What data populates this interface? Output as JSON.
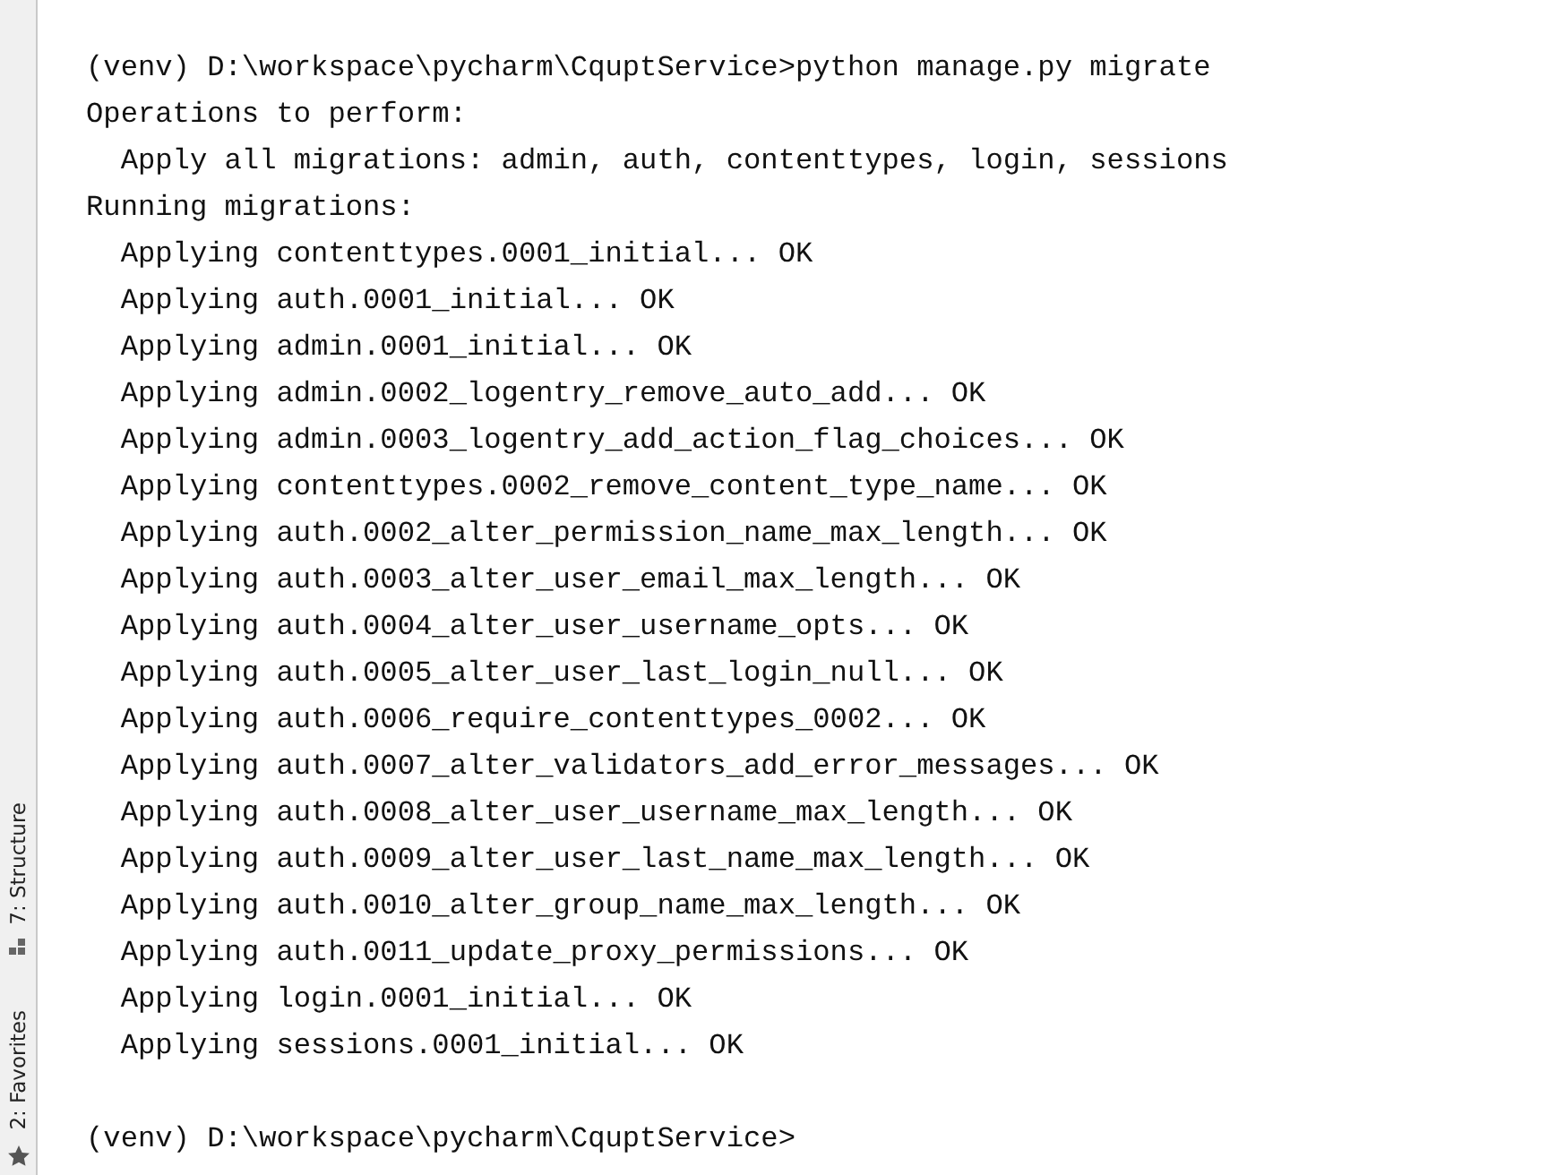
{
  "sidebar": {
    "tabs": [
      {
        "label": "7: Structure",
        "kind": "structure"
      },
      {
        "label": "2: Favorites",
        "kind": "favorites"
      }
    ]
  },
  "terminal": {
    "lines": [
      {
        "text": "(venv) D:\\workspace\\pycharm\\CquptService>python manage.py migrate"
      },
      {
        "text": "Operations to perform:"
      },
      {
        "text": "  Apply all migrations: admin, auth, contenttypes, login, sessions"
      },
      {
        "text": "Running migrations:"
      },
      {
        "text": "  Applying contenttypes.0001_initial... OK"
      },
      {
        "text": "  Applying auth.0001_initial... OK"
      },
      {
        "text": "  Applying admin.0001_initial... OK"
      },
      {
        "text": "  Applying admin.0002_logentry_remove_auto_add... OK"
      },
      {
        "text": "  Applying admin.0003_logentry_add_action_flag_choices... OK"
      },
      {
        "text": "  Applying contenttypes.0002_remove_content_type_name... OK"
      },
      {
        "text": "  Applying auth.0002_alter_permission_name_max_length... OK"
      },
      {
        "text": "  Applying auth.0003_alter_user_email_max_length... OK"
      },
      {
        "text": "  Applying auth.0004_alter_user_username_opts... OK"
      },
      {
        "text": "  Applying auth.0005_alter_user_last_login_null... OK"
      },
      {
        "text": "  Applying auth.0006_require_contenttypes_0002... OK"
      },
      {
        "text": "  Applying auth.0007_alter_validators_add_error_messages... OK"
      },
      {
        "text": "  Applying auth.0008_alter_user_username_max_length... OK"
      },
      {
        "text": "  Applying auth.0009_alter_user_last_name_max_length... OK"
      },
      {
        "text": "  Applying auth.0010_alter_group_name_max_length... OK"
      },
      {
        "text": "  Applying auth.0011_update_proxy_permissions... OK"
      },
      {
        "text": "  Applying login.0001_initial... OK"
      },
      {
        "text": "  Applying sessions.0001_initial... OK"
      },
      {
        "kind": "blank"
      },
      {
        "text": "(venv) D:\\workspace\\pycharm\\CquptService>"
      }
    ]
  }
}
